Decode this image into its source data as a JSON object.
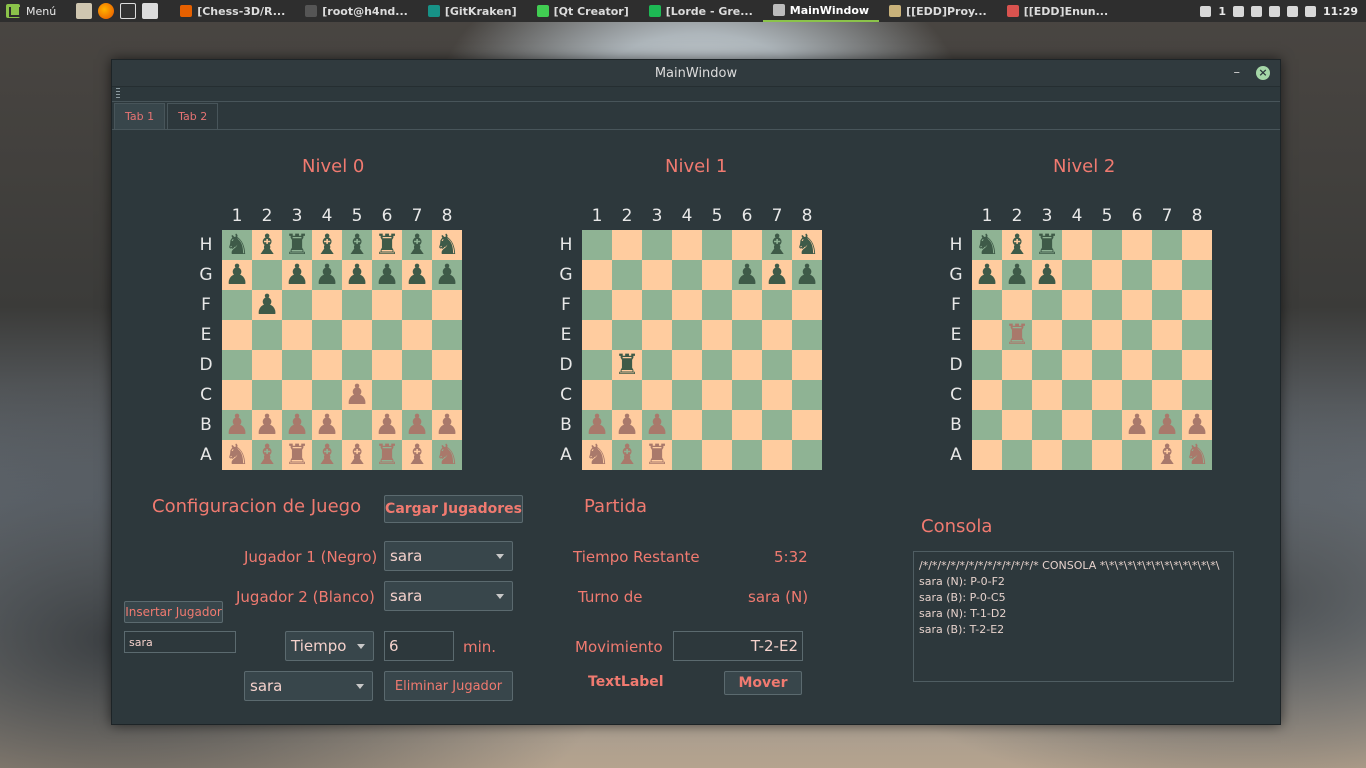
{
  "taskbar": {
    "menu_label": "Menú",
    "windows": [
      {
        "title": "[Chess-3D/R...",
        "icon": "firefox-icon"
      },
      {
        "title": "[root@h4nd...",
        "icon": "terminal-icon"
      },
      {
        "title": "[GitKraken]",
        "icon": "gitkraken-icon"
      },
      {
        "title": "[Qt Creator]",
        "icon": "qt-creator-icon"
      },
      {
        "title": "[Lorde - Gre...",
        "icon": "spotify-icon"
      },
      {
        "title": "MainWindow",
        "icon": "window-icon",
        "active": true
      },
      {
        "title": "[[EDD]Proy...",
        "icon": "folder-icon"
      },
      {
        "title": "[[EDD]Enun...",
        "icon": "document-icon"
      }
    ],
    "notification_count": "1",
    "clock": "11:29"
  },
  "window": {
    "title": "MainWindow",
    "min_glyph": "–",
    "close_glyph": "×",
    "tabs": [
      "Tab 1",
      "Tab 2"
    ]
  },
  "levels": [
    "Nivel 0",
    "Nivel 1",
    "Nivel 2"
  ],
  "board_labels": {
    "cols": [
      "1",
      "2",
      "3",
      "4",
      "5",
      "6",
      "7",
      "8"
    ],
    "rows": [
      "H",
      "G",
      "F",
      "E",
      "D",
      "C",
      "B",
      "A"
    ]
  },
  "boards": [
    {
      "name": "Nivel 0",
      "rows": [
        [
          "bN",
          "bB",
          "bR",
          "bB",
          "bB",
          "bR",
          "bB",
          "bN"
        ],
        [
          "bP",
          "",
          "bP",
          "bP",
          "bP",
          "bP",
          "bP",
          "bP"
        ],
        [
          "",
          "bP",
          "",
          "",
          "",
          "",
          "",
          ""
        ],
        [
          "",
          "",
          "",
          "",
          "",
          "",
          "",
          ""
        ],
        [
          "",
          "",
          "",
          "",
          "",
          "",
          "",
          ""
        ],
        [
          "",
          "",
          "",
          "",
          "wP",
          "",
          "",
          ""
        ],
        [
          "wP",
          "wP",
          "wP",
          "wP",
          "",
          "wP",
          "wP",
          "wP"
        ],
        [
          "wN",
          "wB",
          "wR",
          "wB",
          "wB",
          "wR",
          "wB",
          "wN"
        ]
      ]
    },
    {
      "name": "Nivel 1",
      "rows": [
        [
          "",
          "",
          "",
          "",
          "",
          "",
          "bB",
          "bN"
        ],
        [
          "",
          "",
          "",
          "",
          "",
          "bP",
          "bP",
          "bP"
        ],
        [
          "",
          "",
          "",
          "",
          "",
          "",
          "",
          ""
        ],
        [
          "",
          "",
          "",
          "",
          "",
          "",
          "",
          ""
        ],
        [
          "",
          "bR",
          "",
          "",
          "",
          "",
          "",
          ""
        ],
        [
          "",
          "",
          "",
          "",
          "",
          "",
          "",
          ""
        ],
        [
          "wP",
          "wP",
          "wP",
          "",
          "",
          "",
          "",
          ""
        ],
        [
          "wN",
          "wB",
          "wR",
          "",
          "",
          "",
          "",
          ""
        ]
      ]
    },
    {
      "name": "Nivel 2",
      "rows": [
        [
          "bN",
          "bB",
          "bR",
          "",
          "",
          "",
          "",
          ""
        ],
        [
          "bP",
          "bP",
          "bP",
          "",
          "",
          "",
          "",
          ""
        ],
        [
          "",
          "",
          "",
          "",
          "",
          "",
          "",
          ""
        ],
        [
          "",
          "wR",
          "",
          "",
          "",
          "",
          "",
          ""
        ],
        [
          "",
          "",
          "",
          "",
          "",
          "",
          "",
          ""
        ],
        [
          "",
          "",
          "",
          "",
          "",
          "",
          "",
          ""
        ],
        [
          "",
          "",
          "",
          "",
          "",
          "wP",
          "wP",
          "wP"
        ],
        [
          "",
          "",
          "",
          "",
          "",
          "",
          "wB",
          "wN"
        ]
      ]
    }
  ],
  "config": {
    "title": "Configuracion de Juego",
    "load_players_button": "Cargar Jugadores",
    "player1_label": "Jugador 1 (Negro)",
    "player1_value": "sara",
    "player2_label": "Jugador 2 (Blanco)",
    "player2_value": "sara",
    "insert_player_button": "Insertar Jugador",
    "new_player_value": "sara",
    "time_mode_value": "Tiempo",
    "time_value": "6",
    "time_unit": "min.",
    "delete_player_select_value": "sara",
    "delete_player_button": "Eliminar Jugador"
  },
  "match": {
    "title": "Partida",
    "time_left_label": "Tiempo Restante",
    "time_left_value": "5:32",
    "turn_label": "Turno de",
    "turn_value": "sara (N)",
    "move_label": "Movimiento",
    "move_value": "T-2-E2",
    "text_label": "TextLabel",
    "move_button": "Mover"
  },
  "console": {
    "title": "Consola",
    "lines": [
      "/*/*/*/*/*/*/*/*/*/*/*/*/* CONSOLA *\\*\\*\\*\\*\\*\\*\\*\\*\\*\\*\\*\\*\\",
      "sara (N): P-0-F2",
      "sara (B): P-0-C5",
      "sara (N): T-1-D2",
      "sara (B): T-2-E2"
    ]
  },
  "colors": {
    "accent": "#f07a70",
    "board_light": "#ffcc9f",
    "board_dark": "#8fb394",
    "piece_black": "#3e5a48",
    "piece_white": "#a9796b",
    "window_bg": "#2d383c"
  }
}
